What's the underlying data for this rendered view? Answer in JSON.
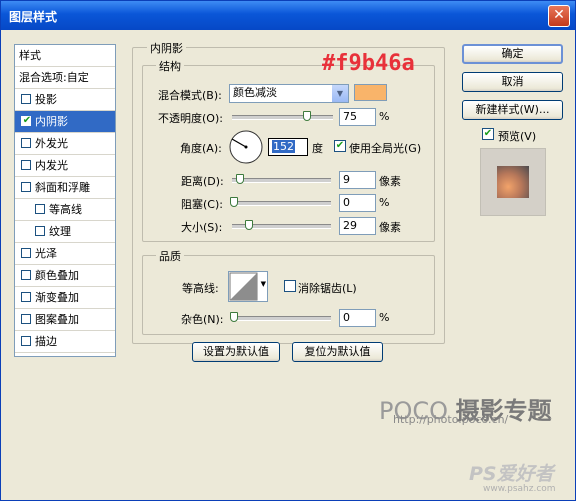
{
  "window": {
    "title": "图层样式",
    "close_symbol": "✕"
  },
  "left_panel": {
    "header": "样式",
    "blend_options": "混合选项:自定",
    "items": [
      {
        "label": "投影",
        "checked": false,
        "selected": false,
        "indent": false
      },
      {
        "label": "内阴影",
        "checked": true,
        "selected": true,
        "indent": false
      },
      {
        "label": "外发光",
        "checked": false,
        "selected": false,
        "indent": false
      },
      {
        "label": "内发光",
        "checked": false,
        "selected": false,
        "indent": false
      },
      {
        "label": "斜面和浮雕",
        "checked": false,
        "selected": false,
        "indent": false
      },
      {
        "label": "等高线",
        "checked": false,
        "selected": false,
        "indent": true
      },
      {
        "label": "纹理",
        "checked": false,
        "selected": false,
        "indent": true
      },
      {
        "label": "光泽",
        "checked": false,
        "selected": false,
        "indent": false
      },
      {
        "label": "颜色叠加",
        "checked": false,
        "selected": false,
        "indent": false
      },
      {
        "label": "渐变叠加",
        "checked": false,
        "selected": false,
        "indent": false
      },
      {
        "label": "图案叠加",
        "checked": false,
        "selected": false,
        "indent": false
      },
      {
        "label": "描边",
        "checked": false,
        "selected": false,
        "indent": false
      }
    ]
  },
  "inner_shadow": {
    "group_title": "内阴影",
    "structure_title": "结构",
    "hex_annotation": "#f9b46a",
    "blend_mode_label": "混合模式(B):",
    "blend_mode_value": "颜色减淡",
    "shadow_color": "#f9b46a",
    "opacity_label": "不透明度(O):",
    "opacity_value": "75",
    "opacity_unit": "%",
    "angle_label": "角度(A):",
    "angle_value": "152",
    "angle_unit": "度",
    "global_light_label": "使用全局光(G)",
    "global_light_checked": true,
    "distance_label": "距离(D):",
    "distance_value": "9",
    "distance_unit": "像素",
    "choke_label": "阻塞(C):",
    "choke_value": "0",
    "choke_unit": "%",
    "size_label": "大小(S):",
    "size_value": "29",
    "size_unit": "像素"
  },
  "quality": {
    "title": "品质",
    "contour_label": "等高线:",
    "antialias_label": "消除锯齿(L)",
    "antialias_checked": false,
    "noise_label": "杂色(N):",
    "noise_value": "0",
    "noise_unit": "%"
  },
  "buttons": {
    "set_default": "设置为默认值",
    "reset_default": "复位为默认值",
    "ok": "确定",
    "cancel": "取消",
    "new_style": "新建样式(W)...",
    "preview_label": "预览(V)",
    "preview_checked": true
  },
  "watermarks": {
    "poco_logo": "POCO",
    "poco_cn": "摄影专题",
    "poco_url": "http://photo.poco.cn/",
    "ps_logo": "PS爱好者",
    "ps_url": "www.psahz.com"
  }
}
